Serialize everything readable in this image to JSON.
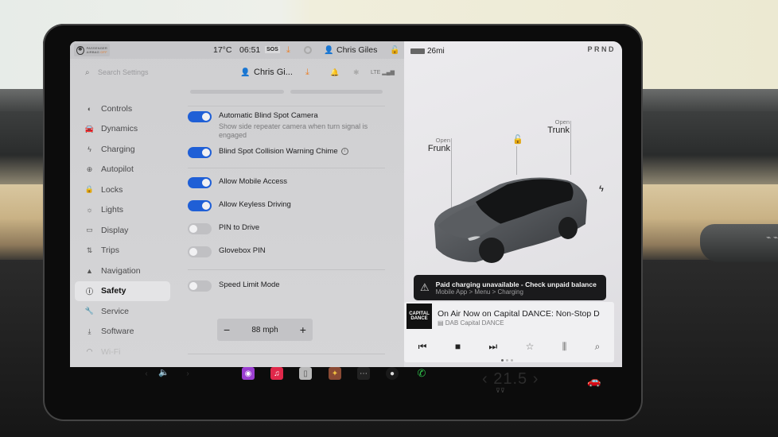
{
  "status_bar": {
    "airbag_label_line1": "PASSENGER",
    "airbag_label_line2": "AIRBAG",
    "airbag_status": "OFF",
    "temperature": "17°C",
    "time": "06:51",
    "sos_label": "SOS",
    "user_name": "Chris Giles",
    "range": "26mi",
    "gear_selector": "PRND"
  },
  "settings_header": {
    "search_placeholder": "Search Settings",
    "profile_name": "Chris Gi...",
    "signal_label": "LTE"
  },
  "sidebar": {
    "items": [
      {
        "label": "Controls",
        "icon": "toggle-icon"
      },
      {
        "label": "Dynamics",
        "icon": "car-icon"
      },
      {
        "label": "Charging",
        "icon": "bolt-icon"
      },
      {
        "label": "Autopilot",
        "icon": "steering-wheel-icon"
      },
      {
        "label": "Locks",
        "icon": "lock-icon"
      },
      {
        "label": "Lights",
        "icon": "light-bulb-icon"
      },
      {
        "label": "Display",
        "icon": "display-icon"
      },
      {
        "label": "Trips",
        "icon": "trips-icon"
      },
      {
        "label": "Navigation",
        "icon": "navigation-icon"
      },
      {
        "label": "Safety",
        "icon": "safety-icon",
        "active": true
      },
      {
        "label": "Service",
        "icon": "wrench-icon"
      },
      {
        "label": "Software",
        "icon": "download-icon"
      },
      {
        "label": "Wi-Fi",
        "icon": "wifi-icon"
      }
    ]
  },
  "safety": {
    "blind_spot_camera": {
      "label": "Automatic Blind Spot Camera",
      "description": "Show side repeater camera when turn signal is engaged",
      "enabled": true
    },
    "blind_spot_chime": {
      "label": "Blind Spot Collision Warning Chime",
      "enabled": true
    },
    "mobile_access": {
      "label": "Allow Mobile Access",
      "enabled": true
    },
    "keyless_driving": {
      "label": "Allow Keyless Driving",
      "enabled": true
    },
    "pin_to_drive": {
      "label": "PIN to Drive",
      "enabled": false
    },
    "glovebox_pin": {
      "label": "Glovebox PIN",
      "enabled": false
    },
    "speed_limit_mode": {
      "label": "Speed Limit Mode",
      "enabled": false
    },
    "speed_limit_value": "88 mph",
    "stepper_minus": "−",
    "stepper_plus": "+"
  },
  "vehicle": {
    "frunk_action": "Open",
    "frunk_label": "Frunk",
    "trunk_action": "Open",
    "trunk_label": "Trunk",
    "lock_state": "unlocked",
    "charge_port_icon": "bolt-icon"
  },
  "alert": {
    "title": "Paid charging unavailable - Check unpaid balance",
    "subtitle": "Mobile App > Menu > Charging"
  },
  "media": {
    "station_logo_text": "CAPITAL DANCE",
    "title": "On Air Now on Capital DANCE: Non-Stop D",
    "source": "DAB Capital DANCE",
    "controls": [
      "previous",
      "stop",
      "next",
      "favorite",
      "equalizer",
      "search"
    ]
  },
  "dock": {
    "apps": [
      "podcasts",
      "music",
      "notepad",
      "toybox",
      "more",
      "camera",
      "phone"
    ],
    "cabin_temperature": "21.5",
    "colors": {
      "podcasts": "#9b3fd1",
      "music": "#e0284a",
      "phone": "#2ec24a",
      "toggle_on": "#1f5fd6",
      "download": "#e8822e"
    }
  }
}
